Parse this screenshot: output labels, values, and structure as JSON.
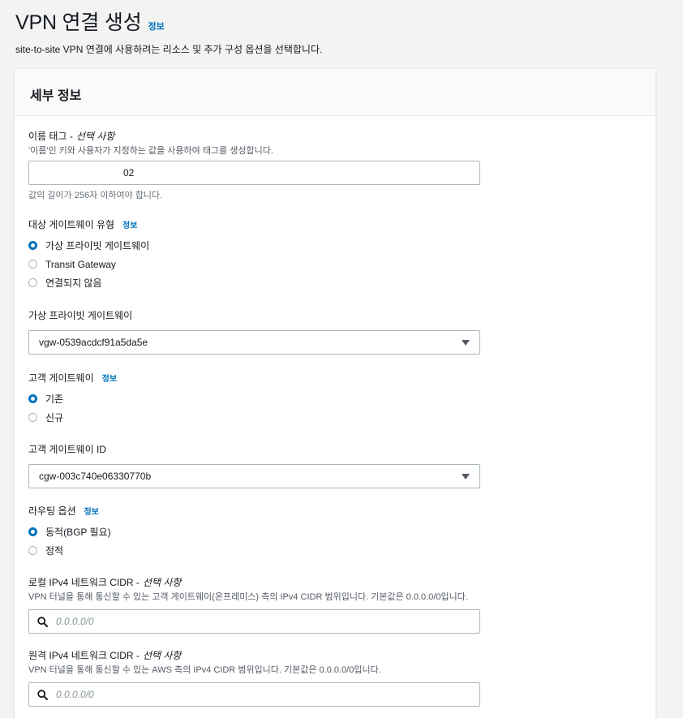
{
  "header": {
    "title": "VPN 연결 생성",
    "info": "정보",
    "description": "site-to-site VPN 연결에 사용하려는 리소스 및 추가 구성 옵션을 선택합니다."
  },
  "panel": {
    "title": "세부 정보"
  },
  "name_tag": {
    "label": "이름 태그 -",
    "optional": "선택 사항",
    "description": "'이름'인 키와 사용자가 지정하는 값을 사용하여 태그를 생성합니다.",
    "value": "02",
    "constraint": "값의 길이가 256자 이하여야 합니다."
  },
  "target_gateway": {
    "label": "대상 게이트웨이 유형",
    "info": "정보",
    "options": [
      {
        "label": "가상 프라이빗 게이트웨이",
        "checked": true
      },
      {
        "label": "Transit Gateway",
        "checked": false
      },
      {
        "label": "연결되지 않음",
        "checked": false
      }
    ]
  },
  "virtual_private_gateway": {
    "label": "가상 프라이빗 게이트웨이",
    "selected": "vgw-0539acdcf91a5da5e"
  },
  "customer_gateway": {
    "label": "고객 게이트웨이",
    "info": "정보",
    "options": [
      {
        "label": "기존",
        "checked": true
      },
      {
        "label": "신규",
        "checked": false
      }
    ]
  },
  "customer_gateway_id": {
    "label": "고객 게이트웨이 ID",
    "selected": "cgw-003c740e06330770b"
  },
  "routing": {
    "label": "라우팅 옵션",
    "info": "정보",
    "options": [
      {
        "label": "동적(BGP 필요)",
        "checked": true
      },
      {
        "label": "정적",
        "checked": false
      }
    ]
  },
  "local_cidr": {
    "label": "로컬 IPv4 네트워크 CIDR -",
    "optional": "선택 사항",
    "description": "VPN 터널을 통해 통신할 수 있는 고객 게이트웨이(온프레미스) 측의 IPv4 CIDR 범위입니다. 기본값은 0.0.0.0/0입니다.",
    "placeholder": "0.0.0.0/0"
  },
  "remote_cidr": {
    "label": "원격 IPv4 네트워크 CIDR -",
    "optional": "선택 사항",
    "description": "VPN 터널을 통해 통신할 수 있는 AWS 측의 IPv4 CIDR 범위입니다. 기본값은 0.0.0.0/0입니다.",
    "placeholder": "0.0.0.0/0"
  },
  "icons": {
    "search": "search-icon",
    "dropdown": "caret-down-icon"
  },
  "colors": {
    "link": "#0073bb",
    "radio_selected": "#0073bb",
    "border": "#aab7b8",
    "background": "#f2f3f3"
  }
}
